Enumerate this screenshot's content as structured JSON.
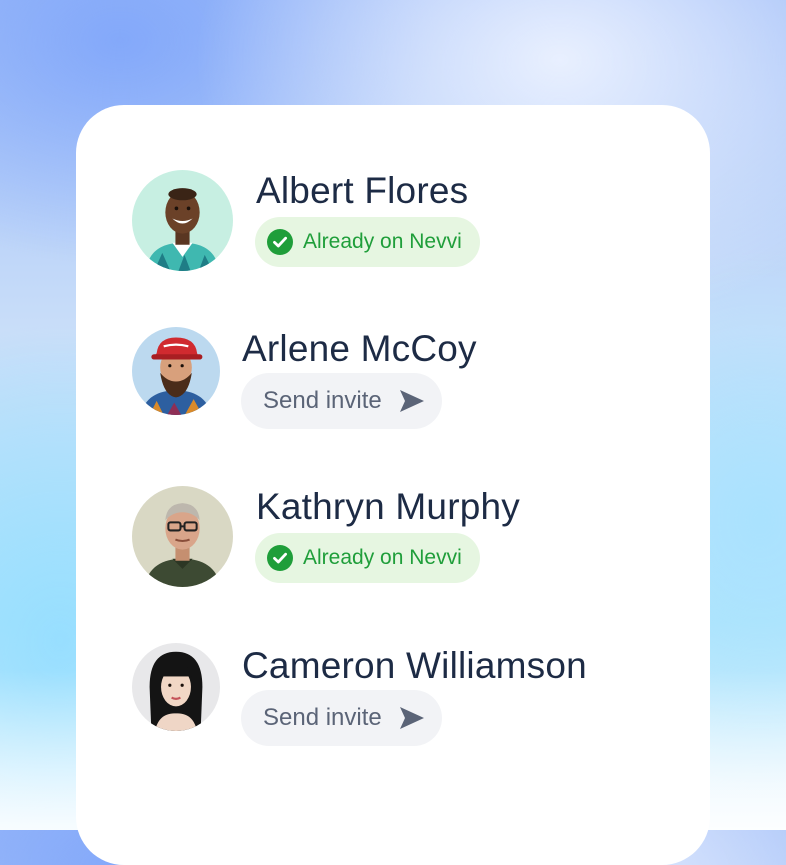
{
  "colors": {
    "name_text": "#1d2b45",
    "badge_bg": "#e6f6e1",
    "badge_text": "#1f9e3a",
    "check_fill": "#1f9e3a",
    "invite_bg": "#f2f3f6",
    "invite_text": "#5b6477"
  },
  "contacts": [
    {
      "name": "Albert Flores",
      "status": "Already on Nevvi",
      "status_icon": "check-circle-icon",
      "avatar": "avatar-albert-flores"
    },
    {
      "name": "Arlene McCoy",
      "action": "Send invite",
      "action_icon": "send-arrow-icon",
      "avatar": "avatar-arlene-mccoy"
    },
    {
      "name": "Kathryn Murphy",
      "status": "Already on Nevvi",
      "status_icon": "check-circle-icon",
      "avatar": "avatar-kathryn-murphy"
    },
    {
      "name": "Cameron Williamson",
      "action": "Send invite",
      "action_icon": "send-arrow-icon",
      "avatar": "avatar-cameron-williamson"
    }
  ]
}
